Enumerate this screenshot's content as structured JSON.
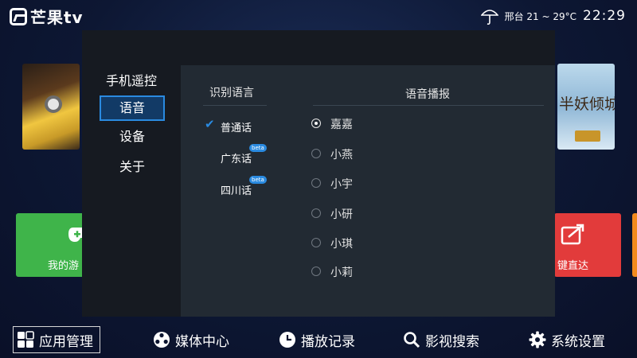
{
  "header": {
    "logo_text": "芒果tv",
    "weather_text": "邢台 21 ~ 29°C",
    "clock": "22:29"
  },
  "background_tiles": {
    "movie_right_title": "半妖倾城",
    "game_tile_label": "我的游",
    "share_tile_label": "键直达"
  },
  "dialog": {
    "title": "手机遥控",
    "sidebar": [
      {
        "label": "语音",
        "active": true
      },
      {
        "label": "设备",
        "active": false
      },
      {
        "label": "关于",
        "active": false
      }
    ],
    "recognition": {
      "heading": "识别语言",
      "items": [
        {
          "label": "普通话",
          "selected": true,
          "beta": ""
        },
        {
          "label": "广东话",
          "selected": false,
          "beta": "beta"
        },
        {
          "label": "四川话",
          "selected": false,
          "beta": "beta"
        }
      ]
    },
    "broadcast": {
      "heading": "语音播报",
      "voices": [
        {
          "label": "嘉嘉",
          "selected": true
        },
        {
          "label": "小燕",
          "selected": false
        },
        {
          "label": "小宇",
          "selected": false
        },
        {
          "label": "小研",
          "selected": false
        },
        {
          "label": "小琪",
          "selected": false
        },
        {
          "label": "小莉",
          "selected": false
        }
      ]
    }
  },
  "bottom_nav": [
    {
      "label": "应用管理",
      "icon": "grid-icon",
      "active": true
    },
    {
      "label": "媒体中心",
      "icon": "film-reel-icon",
      "active": false
    },
    {
      "label": "播放记录",
      "icon": "clock-icon",
      "active": false
    },
    {
      "label": "影视搜索",
      "icon": "search-icon",
      "active": false
    },
    {
      "label": "系统设置",
      "icon": "gear-icon",
      "active": false
    }
  ],
  "colors": {
    "accent_blue": "#2a8ae0",
    "dialog_bg": "#161a21",
    "content_bg": "#222a33",
    "game_tile": "#3fb44a",
    "share_tile": "#e23b3b"
  }
}
